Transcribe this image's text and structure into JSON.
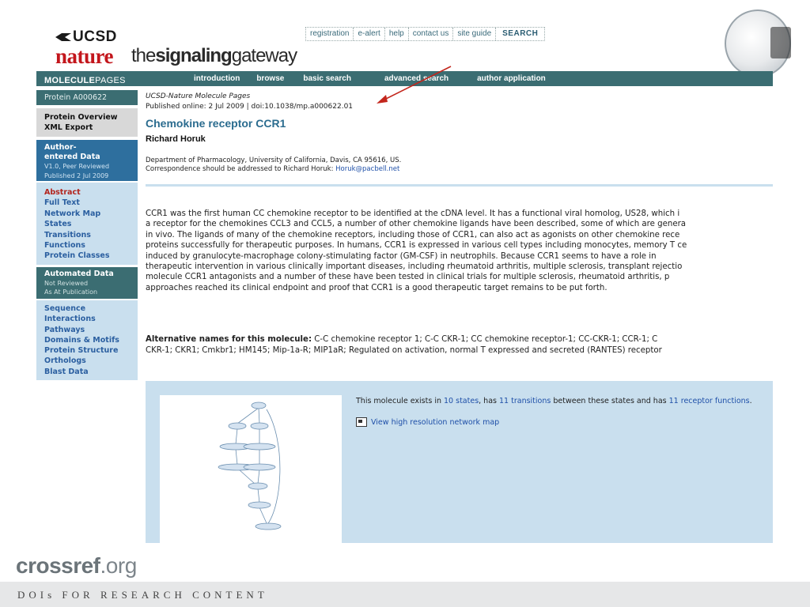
{
  "header": {
    "ucsd": "UCSD",
    "nature": "nature",
    "gateway_prefix": "the",
    "gateway_bold": "signaling",
    "gateway_suffix": "gateway",
    "topbar": [
      "registration",
      "e-alert",
      "help",
      "contact us",
      "site guide"
    ],
    "search": "SEARCH"
  },
  "nav": {
    "logo_bold": "MOLECULE",
    "logo_rest": "PAGES",
    "links": [
      "introduction",
      "browse",
      "basic search",
      "advanced search",
      "author application"
    ]
  },
  "sidebar": {
    "protein_id": "Protein A000622",
    "overview": [
      "Protein Overview",
      "XML Export"
    ],
    "author_title": [
      "Author-",
      "entered Data"
    ],
    "author_sub": [
      "V1.0, Peer Reviewed",
      "Published 2 Jul 2009"
    ],
    "list1": [
      "Abstract",
      "Full Text",
      "Network Map",
      "States",
      "Transitions",
      "Functions",
      "Protein Classes"
    ],
    "auto_title": "Automated Data",
    "auto_sub": [
      "Not Reviewed",
      "As At Publication"
    ],
    "list2": [
      "Sequence",
      "Interactions",
      "Pathways",
      "Domains & Motifs",
      "Protein Structure",
      "Orthologs",
      "Blast Data"
    ]
  },
  "article": {
    "journal": "UCSD-Nature Molecule Pages",
    "published": "Published online: 2 Jul 2009 | doi:10.1038/mp.a000622.01",
    "title": "Chemokine receptor CCR1",
    "author": "Richard Horuk",
    "affiliation": "Department of Pharmacology, University of California, Davis, CA 95616, US.",
    "correspondence": "Correspondence should be addressed to Richard Horuk:",
    "email": "Horuk@pacbell.net",
    "abstract_lines": [
      "CCR1 was the first human CC chemokine receptor to be identified at the cDNA level. It has a functional viral homolog, US28, which i",
      "a receptor for the chemokines CCL3 and CCL5, a number of other chemokine ligands have been described, some of which are genera",
      "in vivo. The ligands of many of the chemokine receptors, including those of CCR1, can also act as agonists on other chemokine rece",
      "proteins successfully for therapeutic purposes. In humans, CCR1 is expressed in various cell types including monocytes, memory T ce",
      "induced by granulocyte-macrophage colony-stimulating factor (GM-CSF) in neutrophils. Because CCR1 seems to have a role in",
      "therapeutic intervention in various clinically important diseases, including rheumatoid arthritis, multiple sclerosis, transplant rejectio",
      "molecule CCR1 antagonists and a number of these have been tested in clinical trials for multiple sclerosis, rheumatoid arthritis, p",
      "approaches reached its clinical endpoint and proof that CCR1 is a good therapeutic target remains to be put forth."
    ],
    "alt_label": "Alternative names for this molecule:",
    "alt_line1": "C-C chemokine receptor 1; C-C CKR-1; CC chemokine receptor-1; CC-CKR-1; CCR-1; C",
    "alt_line2": "CKR-1; CKR1; Cmkbr1; HM145; Mip-1a-R; MIP1aR; Regulated on activation, normal T expressed and secreted (RANTES) receptor"
  },
  "network": {
    "prefix": "This molecule exists in",
    "states": "10 states",
    "mid1": ", has",
    "transitions": "11 transitions",
    "mid2": "between these states and has",
    "functions": "11 receptor functions",
    "suffix": ".",
    "map_link": "View high resolution network map"
  },
  "footer": {
    "crossref_bold": "crossref",
    "crossref_rest": ".org",
    "tagline": "DOIs FOR RESEARCH CONTENT"
  }
}
